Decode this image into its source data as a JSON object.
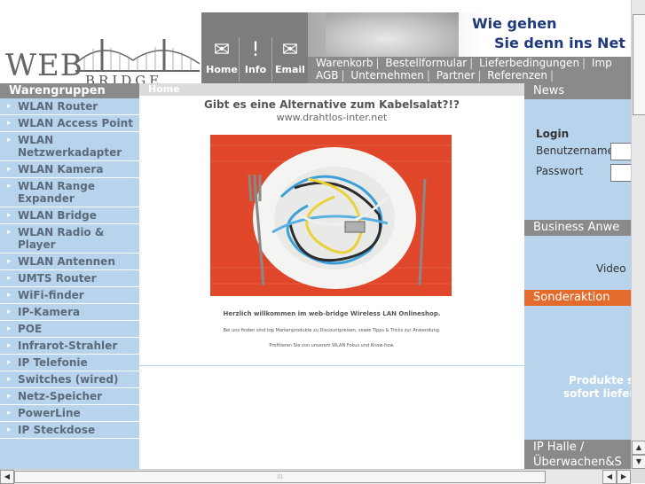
{
  "header": {
    "logo_text": "WEB",
    "logo_sub": "BRIDGE",
    "top_icons": [
      {
        "icon": "home-envelope-icon",
        "glyph": "✉",
        "label": "Home"
      },
      {
        "icon": "info-icon",
        "glyph": "!",
        "label": "Info"
      },
      {
        "icon": "email-icon",
        "glyph": "✉",
        "label": "Email"
      }
    ],
    "banner_line1": "Wie gehen",
    "banner_line2": "Sie denn ins Net",
    "nav_row1": [
      "Warenkorb",
      "Bestellformular",
      "Lieferbedingungen",
      "Imp"
    ],
    "nav_row2": [
      "AGB",
      "Unternehmen",
      "Partner",
      "Referenzen"
    ]
  },
  "sidebar": {
    "title": "Warengruppen",
    "items": [
      "WLAN Router",
      "WLAN Access Point",
      "WLAN Netzwerkadapter",
      "WLAN Kamera",
      "WLAN Range Expander",
      "WLAN Bridge",
      "WLAN Radio & Player",
      "WLAN Antennen",
      "UMTS Router",
      "WiFi-finder",
      "IP-Kamera",
      "POE",
      "Infrarot-Strahler",
      "IP Telefonie",
      "Switches (wired)",
      "Netz-Speicher",
      "PowerLine",
      "IP Steckdose"
    ]
  },
  "main": {
    "breadcrumb": "Home",
    "title": "Gibt es eine Alternative zum Kabelsalat?!?",
    "url": "www.drahtlos-inter.net",
    "welcome": "Herzlich willkommen im web-bridge Wireless LAN Onlineshop.",
    "line2": "Bei uns finden sind top Markenprodukte zu Discountpreisen, sowie Tipps & Tricks zur Anwendung.",
    "line3": "Profitieren Sie von unserem WLAN Fokus und Know-how."
  },
  "right": {
    "news_title": "News",
    "login_title": "Login",
    "username_label": "Benutzername",
    "password_label": "Passwort",
    "business_title": "Business Anwe",
    "video_label": "Video",
    "sonderaktion_title": "Sonderaktion",
    "products_line1": "Produkte s",
    "products_line2": "sofort liefer",
    "iphalle_line1": "IP Halle /",
    "iphalle_line2": "Überwachen&S"
  },
  "colors": {
    "sidebar_bg": "#b8d4ec",
    "header_gray": "#8a8a8a",
    "accent_orange": "#e36b2e",
    "banner_text": "#1f3a7a"
  }
}
